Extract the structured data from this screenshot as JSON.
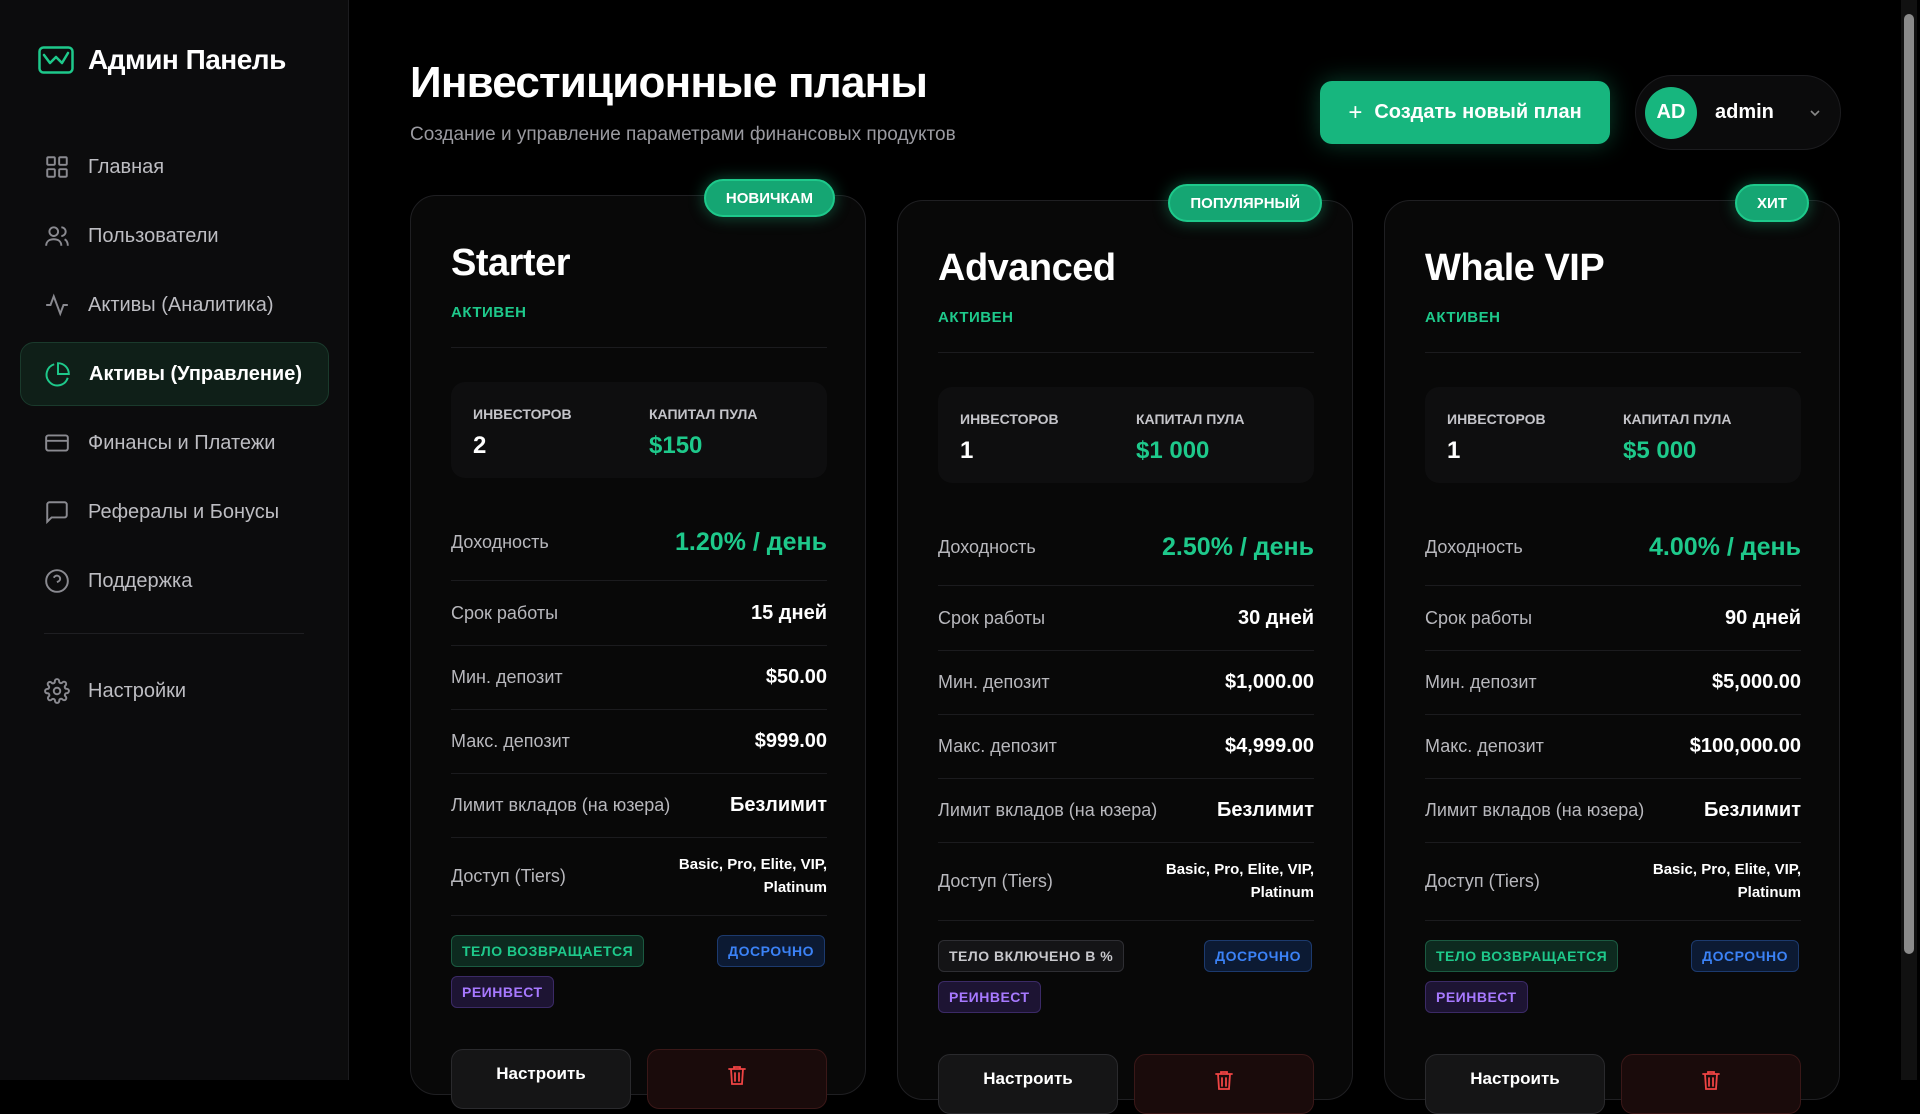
{
  "app": {
    "title": "Админ Панель"
  },
  "sidebar": {
    "items": [
      {
        "label": "Главная",
        "icon": "grid-icon"
      },
      {
        "label": "Пользователи",
        "icon": "users-icon"
      },
      {
        "label": "Активы (Аналитика)",
        "icon": "activity-icon"
      },
      {
        "label": "Активы (Управление)",
        "icon": "pie-chart-icon",
        "active": true
      },
      {
        "label": "Финансы и Платежи",
        "icon": "credit-card-icon"
      },
      {
        "label": "Рефералы и Бонусы",
        "icon": "message-icon"
      },
      {
        "label": "Поддержка",
        "icon": "help-icon"
      }
    ],
    "settings": {
      "label": "Настройки",
      "icon": "gear-icon"
    }
  },
  "header": {
    "title": "Инвестиционные планы",
    "subtitle": "Создание и управление параметрами финансовых продуктов",
    "create_label": "Создать новый план",
    "user": {
      "initials": "AD",
      "name": "admin"
    }
  },
  "labels": {
    "investors": "ИНВЕСТОРОВ",
    "pool": "КАПИТАЛ ПУЛА",
    "yield": "Доходность",
    "term": "Срок работы",
    "min": "Мин. депозит",
    "max": "Макс. депозит",
    "limit": "Лимит вкладов (на юзера)",
    "access": "Доступ (Tiers)",
    "configure": "Настроить"
  },
  "plans": [
    {
      "badge": "НОВИЧКАМ",
      "name": "Starter",
      "status": "АКТИВЕН",
      "investors": "2",
      "pool": "$150",
      "yield": "1.20% / день",
      "term": "15 дней",
      "min": "$50.00",
      "max": "$999.00",
      "limit": "Безлимит",
      "access_1": "Basic, Pro, Elite, VIP,",
      "access_2": "Platinum",
      "tag_1": "ТЕЛО ВОЗВРАЩАЕТСЯ",
      "tag_2": "ДОСРОЧНО",
      "tag_3": "РЕИНВЕСТ"
    },
    {
      "badge": "ПОПУЛЯРНЫЙ",
      "name": "Advanced",
      "status": "АКТИВЕН",
      "investors": "1",
      "pool": "$1 000",
      "yield": "2.50% / день",
      "term": "30 дней",
      "min": "$1,000.00",
      "max": "$4,999.00",
      "limit": "Безлимит",
      "access_1": "Basic, Pro, Elite, VIP,",
      "access_2": "Platinum",
      "tag_1": "ТЕЛО ВКЛЮЧЕНО В %",
      "tag_2": "ДОСРОЧНО",
      "tag_3": "РЕИНВЕСТ"
    },
    {
      "badge": "ХИТ",
      "name": "Whale VIP",
      "status": "АКТИВЕН",
      "investors": "1",
      "pool": "$5 000",
      "yield": "4.00% / день",
      "term": "90 дней",
      "min": "$5,000.00",
      "max": "$100,000.00",
      "limit": "Безлимит",
      "access_1": "Basic, Pro, Elite, VIP,",
      "access_2": "Platinum",
      "tag_1": "ТЕЛО ВОЗВРАЩАЕТСЯ",
      "tag_2": "ДОСРОЧНО",
      "tag_3": "РЕИНВЕСТ"
    }
  ],
  "colors": {
    "accent": "#1ec98b",
    "danger": "#ef4444",
    "blue": "#3b82f6",
    "purple": "#a779ff"
  }
}
